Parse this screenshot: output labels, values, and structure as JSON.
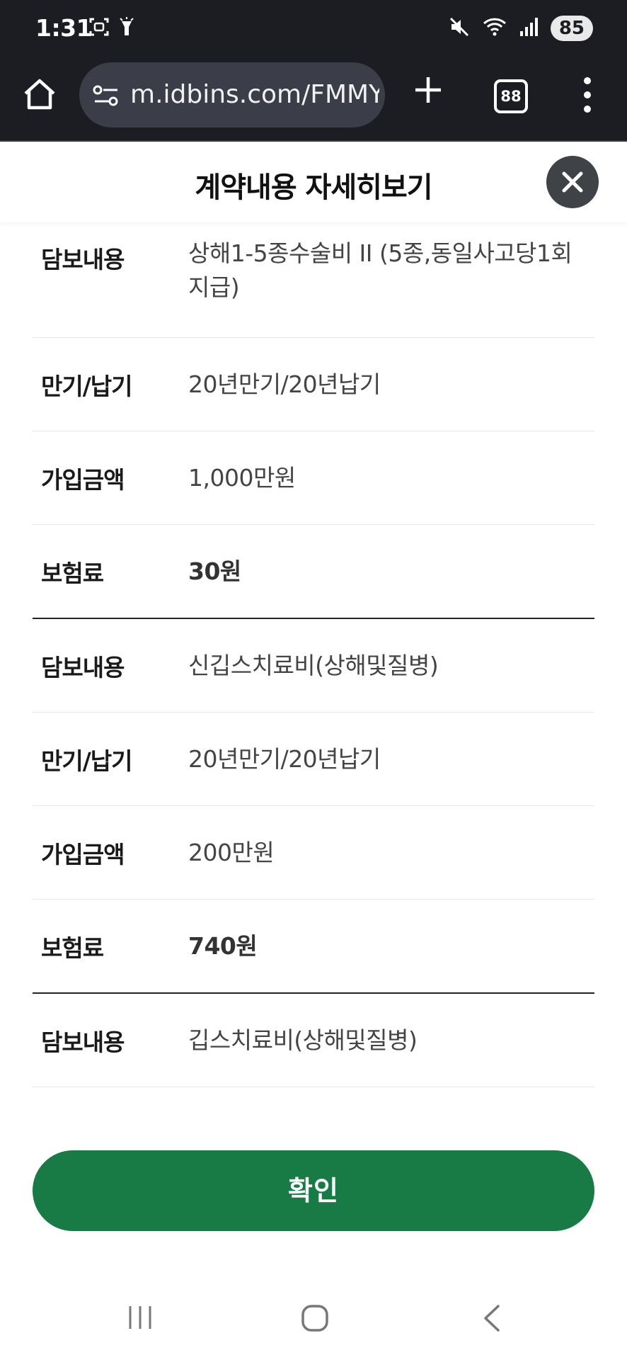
{
  "status_bar": {
    "time": "1:31",
    "battery": "85",
    "icons": [
      "screenshot-icon",
      "flashlight-icon",
      "mute-icon",
      "wifi-icon",
      "signal-icon",
      "battery-icon"
    ]
  },
  "browser": {
    "url": "m.idbins.com/FMMY(",
    "tab_count": "88",
    "icons": [
      "home-icon",
      "site-settings-icon",
      "plus-icon",
      "tabs-icon",
      "more-vert-icon"
    ]
  },
  "modal": {
    "title": "계약내용 자세히보기",
    "close_icon": "close-icon"
  },
  "rows": [
    {
      "label": "담보내용",
      "value": "상해1-5종수술비 II (5종,동일사고당1회 지급)"
    },
    {
      "label": "만기/납기",
      "value": "20년만기/20년납기"
    },
    {
      "label": "가입금액",
      "value": "1,000만원"
    },
    {
      "label": "보험료",
      "value": "30원"
    },
    {
      "label": "담보내용",
      "value": "신깁스치료비(상해및질병)"
    },
    {
      "label": "만기/납기",
      "value": "20년만기/20년납기"
    },
    {
      "label": "가입금액",
      "value": "200만원"
    },
    {
      "label": "보험료",
      "value": "740원"
    },
    {
      "label": "담보내용",
      "value": "깁스치료비(상해및질병)"
    }
  ],
  "confirm": {
    "label": "확인"
  },
  "colors": {
    "system_bar": "#1c1d22",
    "url_box": "#3b3d48",
    "confirm": "#187a45",
    "close_button": "#3f4247"
  },
  "nav_bar": {
    "icons": [
      "recent-apps-icon",
      "home-nav-icon",
      "back-icon"
    ]
  }
}
